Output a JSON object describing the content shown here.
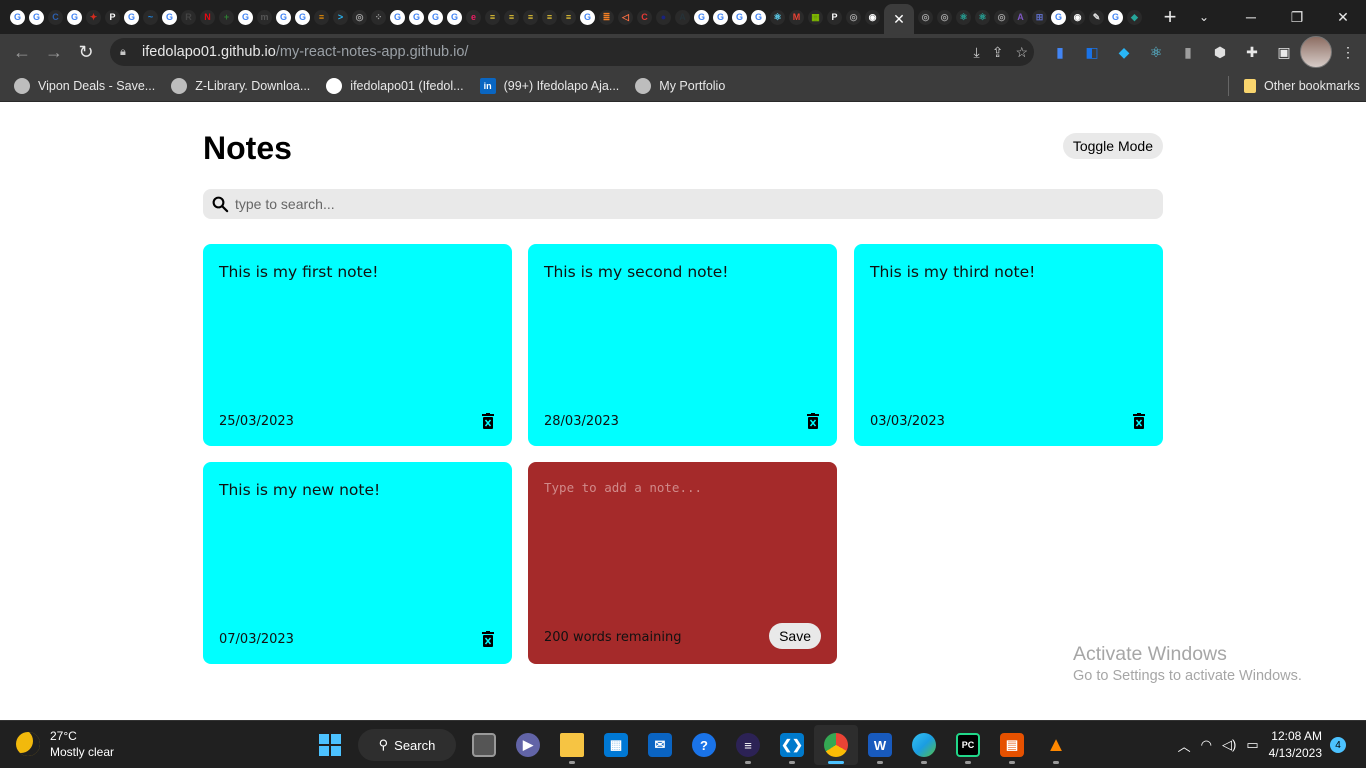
{
  "browser": {
    "favicons": [
      {
        "icon": "google-icon",
        "color": "#4285f4",
        "glyph": "G"
      },
      {
        "icon": "google-icon",
        "color": "#4285f4",
        "glyph": "G"
      },
      {
        "icon": "c-icon",
        "color": "#2d5fae",
        "glyph": "C"
      },
      {
        "icon": "google-icon",
        "color": "#4285f4",
        "glyph": "G"
      },
      {
        "icon": "maple-leaf-icon",
        "color": "#d52b1e",
        "glyph": "✦"
      },
      {
        "icon": "p-icon",
        "color": "#ffffff",
        "glyph": "P"
      },
      {
        "icon": "google-icon",
        "color": "#4285f4",
        "glyph": "G"
      },
      {
        "icon": "arrow-icon",
        "color": "#1e88e5",
        "glyph": "~"
      },
      {
        "icon": "google-icon",
        "color": "#4285f4",
        "glyph": "G"
      },
      {
        "icon": "r-icon",
        "color": "#444444",
        "glyph": "R"
      },
      {
        "icon": "netflix-icon",
        "color": "#e50914",
        "glyph": "N"
      },
      {
        "icon": "plus-icon",
        "color": "#2e7d32",
        "glyph": "+"
      },
      {
        "icon": "google-icon",
        "color": "#4285f4",
        "glyph": "G"
      },
      {
        "icon": "m-icon",
        "color": "#555555",
        "glyph": "m"
      },
      {
        "icon": "google-icon",
        "color": "#4285f4",
        "glyph": "G"
      },
      {
        "icon": "google-icon",
        "color": "#4285f4",
        "glyph": "G"
      },
      {
        "icon": "bars-icon",
        "color": "#ff9800",
        "glyph": "≡"
      },
      {
        "icon": "chevron-icon",
        "color": "#29b6f6",
        "glyph": ">"
      },
      {
        "icon": "globe-icon",
        "color": "#9e9e9e",
        "glyph": "◎"
      },
      {
        "icon": "grid-icon",
        "color": "#9e9e9e",
        "glyph": "⁘"
      },
      {
        "icon": "google-icon",
        "color": "#4285f4",
        "glyph": "G"
      },
      {
        "icon": "google-icon",
        "color": "#4285f4",
        "glyph": "G"
      },
      {
        "icon": "google-icon",
        "color": "#4285f4",
        "glyph": "G"
      },
      {
        "icon": "google-icon",
        "color": "#4285f4",
        "glyph": "G"
      },
      {
        "icon": "e-icon",
        "color": "#e91e63",
        "glyph": "e"
      },
      {
        "icon": "note-icon",
        "color": "#fdd835",
        "glyph": "≡"
      },
      {
        "icon": "note-icon",
        "color": "#fdd835",
        "glyph": "≡"
      },
      {
        "icon": "note-icon",
        "color": "#fdd835",
        "glyph": "≡"
      },
      {
        "icon": "note-icon",
        "color": "#fdd835",
        "glyph": "≡"
      },
      {
        "icon": "note-icon",
        "color": "#fdd835",
        "glyph": "≡"
      },
      {
        "icon": "google-icon",
        "color": "#4285f4",
        "glyph": "G"
      },
      {
        "icon": "stack-icon",
        "color": "#f48024",
        "glyph": "≣"
      },
      {
        "icon": "sound-icon",
        "color": "#ff7043",
        "glyph": "◁"
      },
      {
        "icon": "c-icon",
        "color": "#e53935",
        "glyph": "C"
      },
      {
        "icon": "circle-icon",
        "color": "#1a237e",
        "glyph": "●"
      },
      {
        "icon": "a-icon",
        "color": "#263238",
        "glyph": "A"
      },
      {
        "icon": "google-icon",
        "color": "#4285f4",
        "glyph": "G"
      },
      {
        "icon": "google-icon",
        "color": "#4285f4",
        "glyph": "G"
      },
      {
        "icon": "google-icon",
        "color": "#4285f4",
        "glyph": "G"
      },
      {
        "icon": "google-icon",
        "color": "#4285f4",
        "glyph": "G"
      },
      {
        "icon": "react-icon",
        "color": "#61dafb",
        "glyph": "⚛"
      },
      {
        "icon": "gmail-icon",
        "color": "#ea4335",
        "glyph": "M"
      },
      {
        "icon": "microsoft-icon",
        "color": "#7fba00",
        "glyph": "▦"
      },
      {
        "icon": "pin-icon",
        "color": "#ffffff",
        "glyph": "P"
      },
      {
        "icon": "globe-icon",
        "color": "#9e9e9e",
        "glyph": "◎"
      },
      {
        "icon": "github-icon",
        "color": "#ffffff",
        "glyph": "◉"
      }
    ],
    "favicons_after": [
      {
        "icon": "globe-icon",
        "color": "#9e9e9e",
        "glyph": "◎"
      },
      {
        "icon": "globe-icon",
        "color": "#9e9e9e",
        "glyph": "◎"
      },
      {
        "icon": "react-icon",
        "color": "#26a69a",
        "glyph": "⚛"
      },
      {
        "icon": "react-icon",
        "color": "#26a69a",
        "glyph": "⚛"
      },
      {
        "icon": "globe-icon",
        "color": "#9e9e9e",
        "glyph": "◎"
      },
      {
        "icon": "a-icon",
        "color": "#7e57c2",
        "glyph": "A"
      },
      {
        "icon": "code-icon",
        "color": "#5c6bc0",
        "glyph": "⊞"
      },
      {
        "icon": "google-icon",
        "color": "#4285f4",
        "glyph": "G"
      },
      {
        "icon": "github-icon",
        "color": "#ffffff",
        "glyph": "◉"
      },
      {
        "icon": "bird-icon",
        "color": "#e0e0e0",
        "glyph": "✎"
      },
      {
        "icon": "google-icon",
        "color": "#4285f4",
        "glyph": "G"
      },
      {
        "icon": "shield-icon",
        "color": "#26a69a",
        "glyph": "◆"
      }
    ],
    "active_tab_close": "✕",
    "new_tab": "+",
    "url_host": "ifedolapo01.github.io",
    "url_path": "/my-react-notes-app.github.io/",
    "bookmarks": [
      {
        "label": "Vipon Deals - Save...",
        "icon": "globe-icon"
      },
      {
        "label": "Z-Library. Downloa...",
        "icon": "globe-icon"
      },
      {
        "label": "ifedolapo01 (Ifedol...",
        "icon": "github-icon"
      },
      {
        "label": "(99+) Ifedolapo Aja...",
        "icon": "linkedin-icon"
      },
      {
        "label": "My Portfolio",
        "icon": "globe-icon"
      }
    ],
    "other_bookmarks": "Other bookmarks"
  },
  "app": {
    "title": "Notes",
    "toggle_label": "Toggle Mode",
    "search_placeholder": "type to search...",
    "notes": [
      {
        "text": "This is my first note!",
        "date": "25/03/2023"
      },
      {
        "text": "This is my second note!",
        "date": "28/03/2023"
      },
      {
        "text": "This is my third note!",
        "date": "03/03/2023"
      },
      {
        "text": "This is my new note!",
        "date": "07/03/2023"
      }
    ],
    "new_note": {
      "placeholder": "Type to add a note...",
      "remaining": "200 words remaining",
      "save_label": "Save"
    },
    "colors": {
      "note_bg": "#00ffff",
      "new_note_bg": "#a52a2a"
    }
  },
  "watermark": {
    "line1": "Activate Windows",
    "line2": "Go to Settings to activate Windows."
  },
  "taskbar": {
    "temperature": "27°C",
    "condition": "Mostly clear",
    "search_label": "Search",
    "time": "12:08 AM",
    "date": "4/13/2023",
    "notification_count": "4"
  }
}
